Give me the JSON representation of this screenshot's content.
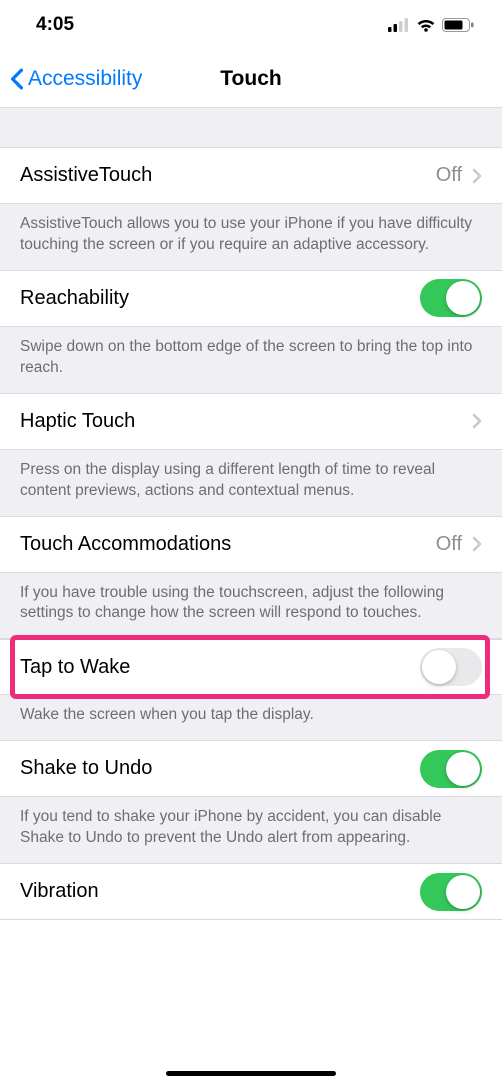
{
  "status": {
    "time": "4:05"
  },
  "nav": {
    "back_label": "Accessibility",
    "title": "Touch"
  },
  "rows": {
    "assistive": {
      "label": "AssistiveTouch",
      "value": "Off",
      "footer": "AssistiveTouch allows you to use your iPhone if you have difficulty touching the screen or if you require an adaptive accessory."
    },
    "reachability": {
      "label": "Reachability",
      "on": true,
      "footer": "Swipe down on the bottom edge of the screen to bring the top into reach."
    },
    "haptic": {
      "label": "Haptic Touch",
      "footer": "Press on the display using a different length of time to reveal content previews, actions and contextual menus."
    },
    "accommodations": {
      "label": "Touch Accommodations",
      "value": "Off",
      "footer": "If you have trouble using the touchscreen, adjust the following settings to change how the screen will respond to touches."
    },
    "taptowake": {
      "label": "Tap to Wake",
      "on": false,
      "footer": "Wake the screen when you tap the display."
    },
    "shaketoundo": {
      "label": "Shake to Undo",
      "on": true,
      "footer": "If you tend to shake your iPhone by accident, you can disable Shake to Undo to prevent the Undo alert from appearing."
    },
    "vibration": {
      "label": "Vibration",
      "on": true
    }
  }
}
